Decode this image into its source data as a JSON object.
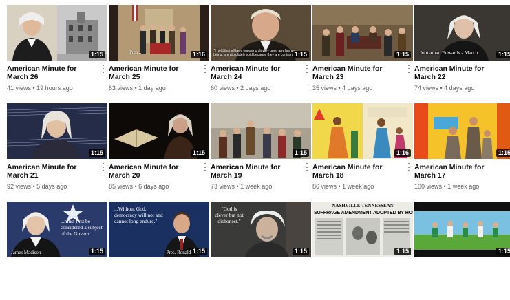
{
  "videos": [
    {
      "id": "v26",
      "title": "American Minute for March 26",
      "views": "41 views",
      "age": "19 hours ago",
      "duration": "1:15",
      "caption": ""
    },
    {
      "id": "v25",
      "title": "American Minute for March 25",
      "views": "63 views",
      "age": "1 day ago",
      "duration": "1:16",
      "caption": "Pres..."
    },
    {
      "id": "v24",
      "title": "American Minute for March 24",
      "views": "60 views",
      "age": "2 days ago",
      "duration": "1:15",
      "caption": "\"I hold that all laws imposing slavery upon any human being, are absolutely void because they are contrary..."
    },
    {
      "id": "v23",
      "title": "American Minute for March 23",
      "views": "35 views",
      "age": "4 days ago",
      "duration": "1:15",
      "caption": ""
    },
    {
      "id": "v22",
      "title": "American Minute for March 22",
      "views": "74 views",
      "age": "4 days ago",
      "duration": "1:15",
      "caption": "Johnathan Edwards - March"
    },
    {
      "id": "v21",
      "title": "American Minute for March 21",
      "views": "92 views",
      "age": "5 days ago",
      "duration": "1:15",
      "caption": ""
    },
    {
      "id": "v20",
      "title": "American Minute for March 20",
      "views": "85 views",
      "age": "6 days ago",
      "duration": "1:15",
      "caption": ""
    },
    {
      "id": "v19",
      "title": "American Minute for March 19",
      "views": "73 views",
      "age": "1 week ago",
      "duration": "1:15",
      "caption": ""
    },
    {
      "id": "v18",
      "title": "American Minute for March 18",
      "views": "86 views",
      "age": "1 week ago",
      "duration": "1:16",
      "caption": ""
    },
    {
      "id": "v17",
      "title": "American Minute for March 17",
      "views": "100 views",
      "age": "1 week ago",
      "duration": "1:15",
      "caption": ""
    },
    {
      "id": "v16",
      "title": "",
      "views": "",
      "age": "",
      "duration": "1:15",
      "caption": "James Madison",
      "quote": "...must first be considered a subject of the Govern"
    },
    {
      "id": "v15",
      "title": "",
      "views": "",
      "age": "",
      "duration": "1:15",
      "caption": "Pres. Ronald Rea",
      "quote": "...Without God, democracy will not and cannot long endure.\""
    },
    {
      "id": "v14",
      "title": "",
      "views": "",
      "age": "",
      "duration": "1:15",
      "caption": "",
      "quote": "\"God is clever but not dishonest.\""
    },
    {
      "id": "v13",
      "title": "",
      "views": "",
      "age": "",
      "duration": "1:15",
      "caption": "",
      "masthead": "NASHVILLE TENNESSEAN",
      "headline": "SUFFRAGE AMENDMENT ADOPTED BY HOUSE"
    },
    {
      "id": "v12",
      "title": "",
      "views": "",
      "age": "",
      "duration": "1:15",
      "caption": ""
    }
  ],
  "separator": " • ",
  "colors": {
    "title": "#0f0f0f",
    "meta": "#606060",
    "duration_bg": "#000000"
  }
}
